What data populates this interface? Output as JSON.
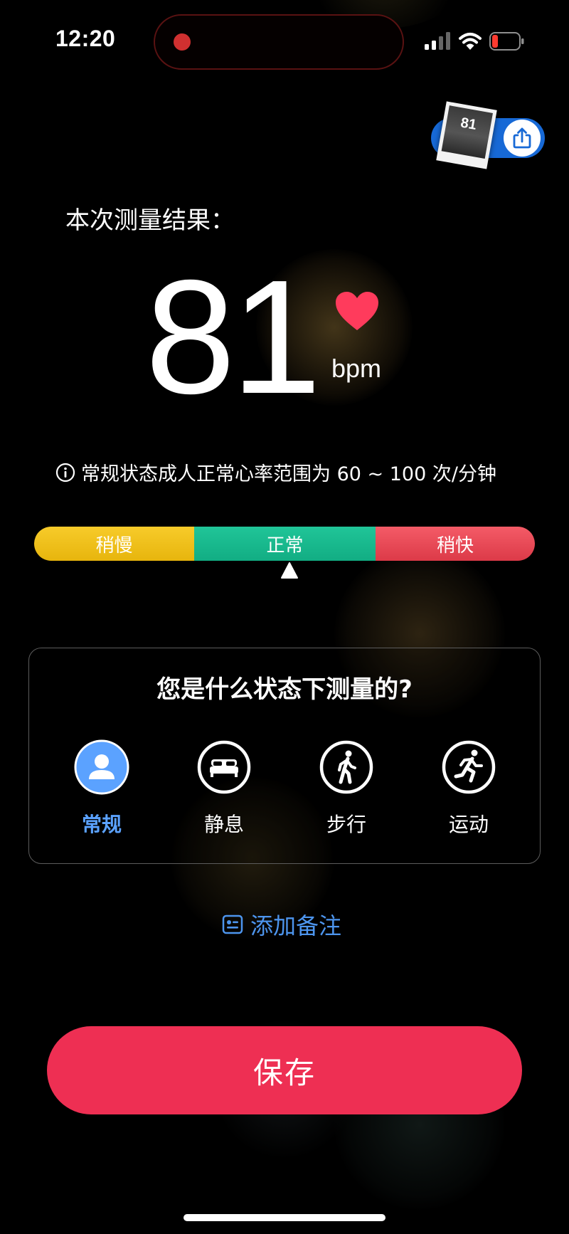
{
  "status_bar": {
    "time": "12:20",
    "icons": [
      "recording-dot-icon",
      "signal-icon",
      "wifi-icon",
      "battery-low-icon"
    ]
  },
  "share": {
    "thumbnail_value": "81",
    "icon": "share-icon"
  },
  "result": {
    "title": "本次测量结果：",
    "value": "81",
    "unit": "bpm",
    "heart_color": "#ff3b5c"
  },
  "info": {
    "icon": "info-icon",
    "text": "常规状态成人正常心率范围为 60 ~ 100 次/分钟"
  },
  "range_bar": {
    "segments": [
      {
        "label": "稍慢",
        "color": "#f2c31c"
      },
      {
        "label": "正常",
        "color": "#18b98c"
      },
      {
        "label": "稍快",
        "color": "#e84a57"
      }
    ],
    "indicator_segment": "正常"
  },
  "state_card": {
    "title": "您是什么状态下测量的?",
    "options": [
      {
        "label": "常规",
        "icon": "person-icon",
        "selected": true
      },
      {
        "label": "静息",
        "icon": "bed-icon",
        "selected": false
      },
      {
        "label": "步行",
        "icon": "walking-icon",
        "selected": false
      },
      {
        "label": "运动",
        "icon": "running-icon",
        "selected": false
      }
    ]
  },
  "note": {
    "icon": "note-icon",
    "label": "添加备注"
  },
  "save_button": {
    "label": "保存",
    "color": "#ee2f53"
  },
  "accent_color": "#4d95ee"
}
